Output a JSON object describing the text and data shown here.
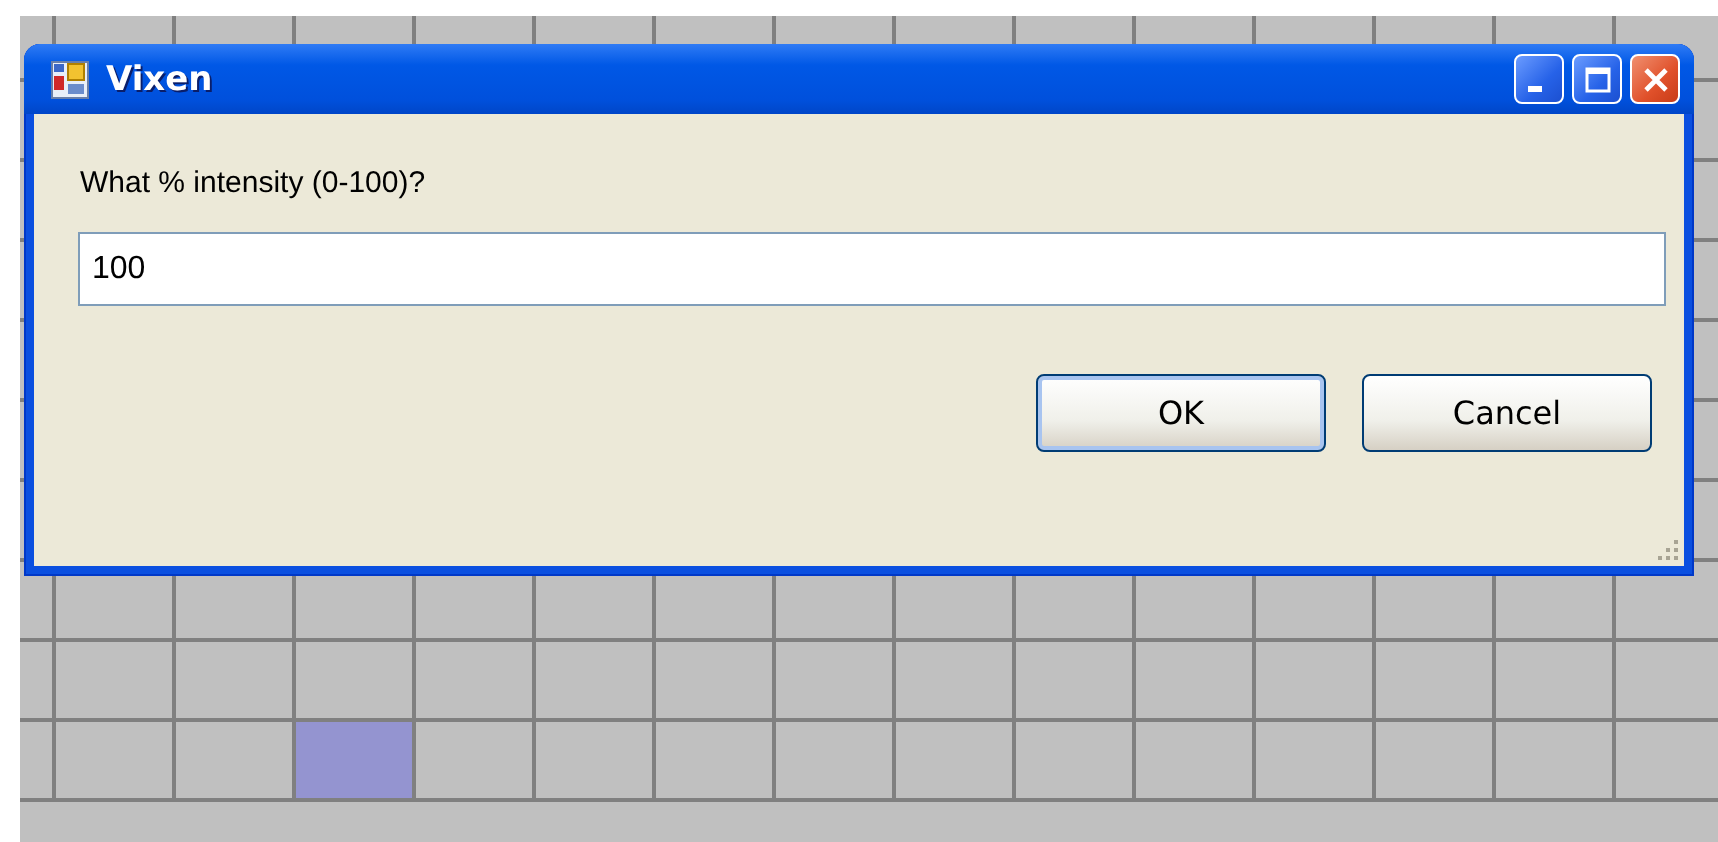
{
  "window": {
    "title": "Vixen"
  },
  "prompt": "What % intensity (0-100)?",
  "input": {
    "value": "100"
  },
  "buttons": [
    {
      "label": "OK",
      "default": true
    },
    {
      "label": "Cancel",
      "default": false
    }
  ]
}
